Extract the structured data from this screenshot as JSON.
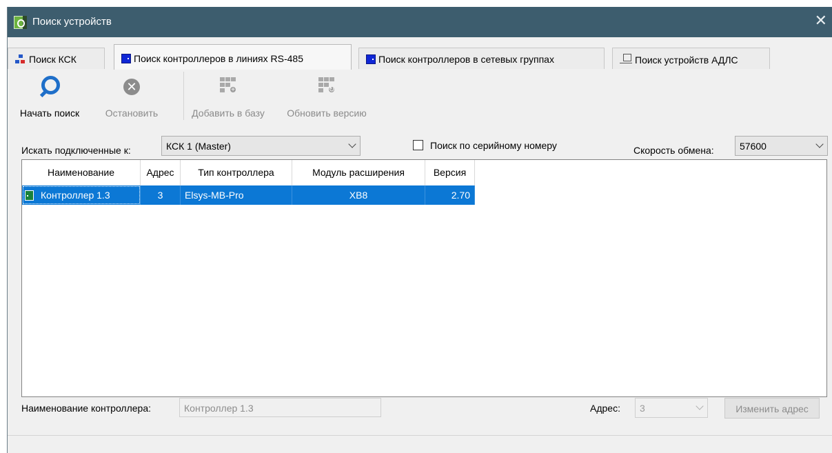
{
  "window": {
    "title": "Поиск устройств",
    "close_glyph": "✕"
  },
  "tabs": [
    {
      "label": "Поиск КСК",
      "icon": "network-icon",
      "active": false
    },
    {
      "label": "Поиск контроллеров в линиях RS-485",
      "icon": "controller-icon",
      "active": true
    },
    {
      "label": "Поиск контроллеров в сетевых группах",
      "icon": "controller-icon",
      "active": false
    },
    {
      "label": "Поиск устройств АДЛС",
      "icon": "computer-icon",
      "active": false
    }
  ],
  "toolbar": {
    "start_search": "Начать поиск",
    "stop": "Остановить",
    "add_to_db": "Добавить в базу",
    "update_version": "Обновить версию"
  },
  "options": {
    "search_connected_label": "Искать подключенные к:",
    "search_connected_value": "КСК 1 (Master)",
    "serial_search_label": "Поиск по серийному номеру",
    "serial_search_checked": false,
    "baud_label": "Скорость обмена:",
    "baud_value": "57600"
  },
  "table": {
    "columns": [
      "Наименование",
      "Адрес",
      "Тип контроллера",
      "Модуль расширения",
      "Версия"
    ],
    "rows": [
      {
        "name": "Контроллер 1.3",
        "address": "3",
        "type": "Elsys-MB-Pro",
        "module": "XB8",
        "version": "2.70",
        "selected": true
      }
    ]
  },
  "bottom": {
    "controller_name_label": "Наименование контроллера:",
    "controller_name_value": "Контроллер 1.3",
    "address_label": "Адрес:",
    "address_value": "3",
    "change_address_button": "Изменить адрес"
  },
  "colors": {
    "titlebar": "#3d5d6e",
    "selection": "#0c78d5",
    "search_icon": "#1f6fc9"
  }
}
